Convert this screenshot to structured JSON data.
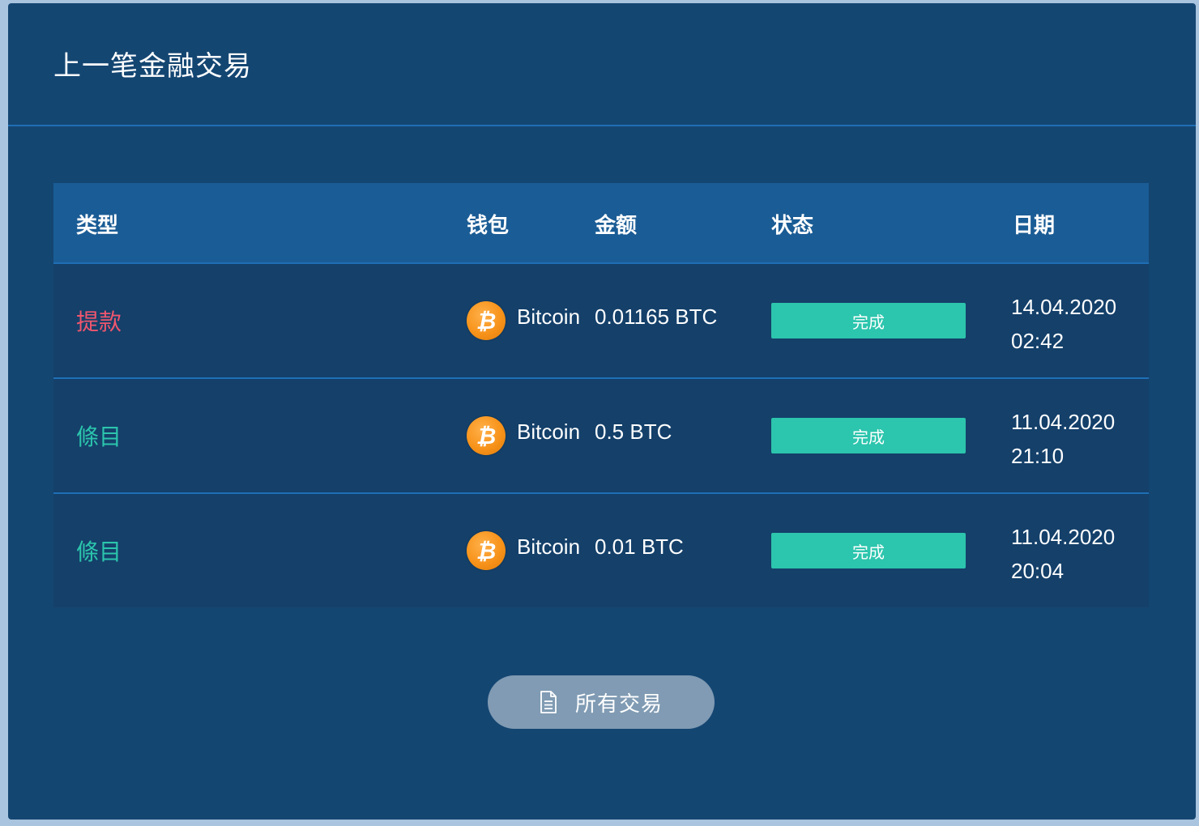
{
  "panel": {
    "title": "上一笔金融交易"
  },
  "table": {
    "headers": {
      "type": "类型",
      "wallet": "钱包",
      "amount": "金额",
      "status": "状态",
      "date": "日期"
    },
    "rows": [
      {
        "type": "提款",
        "type_kind": "withdraw",
        "coin_icon": "bitcoin-icon",
        "coin_symbol": "₿",
        "wallet": "Bitcoin",
        "amount": "0.01165 BTC",
        "status": "完成",
        "date": "14.04.2020",
        "time": "02:42"
      },
      {
        "type": "條目",
        "type_kind": "deposit",
        "coin_icon": "bitcoin-icon",
        "coin_symbol": "₿",
        "wallet": "Bitcoin",
        "amount": "0.5 BTC",
        "status": "完成",
        "date": "11.04.2020",
        "time": "21:10"
      },
      {
        "type": "條目",
        "type_kind": "deposit",
        "coin_icon": "bitcoin-icon",
        "coin_symbol": "₿",
        "wallet": "Bitcoin",
        "amount": "0.01 BTC",
        "status": "完成",
        "date": "11.04.2020",
        "time": "20:04"
      }
    ]
  },
  "footer": {
    "all_transactions_label": "所有交易",
    "all_transactions_icon": "document-icon"
  },
  "colors": {
    "panel_bg": "#144672",
    "header_bg": "#1a5c95",
    "withdraw": "#f0566e",
    "deposit": "#2cc5ad",
    "status_complete": "#2cc5ad",
    "bitcoin": "#f7931a",
    "button_bg": "#809bb3"
  }
}
